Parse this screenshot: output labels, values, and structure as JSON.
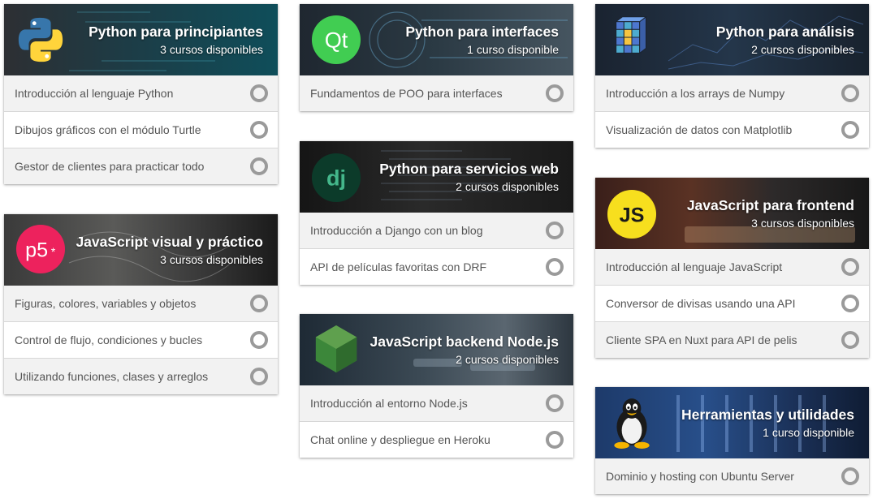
{
  "cards": [
    {
      "title": "Python para principiantes",
      "subtitle": "3 cursos disponibles",
      "icon": "python-logo-icon",
      "courses": [
        "Introducción al lenguaje Python",
        "Dibujos gráficos con el módulo Turtle",
        "Gestor de clientes para practicar todo"
      ]
    },
    {
      "title": "JavaScript visual y práctico",
      "subtitle": "3 cursos disponibles",
      "icon": "p5-logo-icon",
      "logo_text": "p5",
      "courses": [
        "Figuras, colores, variables y objetos",
        "Control de flujo, condiciones y bucles",
        "Utilizando funciones, clases y arreglos"
      ]
    },
    {
      "title": "Python para interfaces",
      "subtitle": "1 curso disponible",
      "icon": "qt-logo-icon",
      "logo_text": "Qt",
      "courses": [
        "Fundamentos de POO para interfaces"
      ]
    },
    {
      "title": "Python para servicios web",
      "subtitle": "2 cursos disponibles",
      "icon": "django-logo-icon",
      "logo_text": "dj",
      "courses": [
        "Introducción a Django con un blog",
        "API de películas favoritas con DRF"
      ]
    },
    {
      "title": "JavaScript backend Node.js",
      "subtitle": "2 cursos disponibles",
      "icon": "nodejs-logo-icon",
      "courses": [
        "Introducción al entorno Node.js",
        "Chat online y despliegue en Heroku"
      ]
    },
    {
      "title": "Python para análisis",
      "subtitle": "2 cursos disponibles",
      "icon": "numpy-logo-icon",
      "courses": [
        "Introducción a los arrays de Numpy",
        "Visualización de datos con Matplotlib"
      ]
    },
    {
      "title": "JavaScript para frontend",
      "subtitle": "3 cursos disponibles",
      "icon": "js-logo-icon",
      "logo_text": "JS",
      "courses": [
        "Introducción al lenguaje JavaScript",
        "Conversor de divisas usando una API",
        "Cliente SPA en Nuxt para API de pelis"
      ]
    },
    {
      "title": "Herramientas y utilidades",
      "subtitle": "1 curso disponible",
      "icon": "tux-penguin-icon",
      "courses": [
        "Dominio y hosting con Ubuntu Server"
      ]
    }
  ],
  "colors": {
    "status_circle": "#9a9a9a",
    "course_text": "#555555",
    "python_blue": "#3776ab",
    "python_yellow": "#ffd43b",
    "qt_green": "#41cd52",
    "django_green": "#0c4b33",
    "node_green": "#3c873a",
    "p5_pink": "#ed225d",
    "js_yellow": "#f7df1e"
  }
}
